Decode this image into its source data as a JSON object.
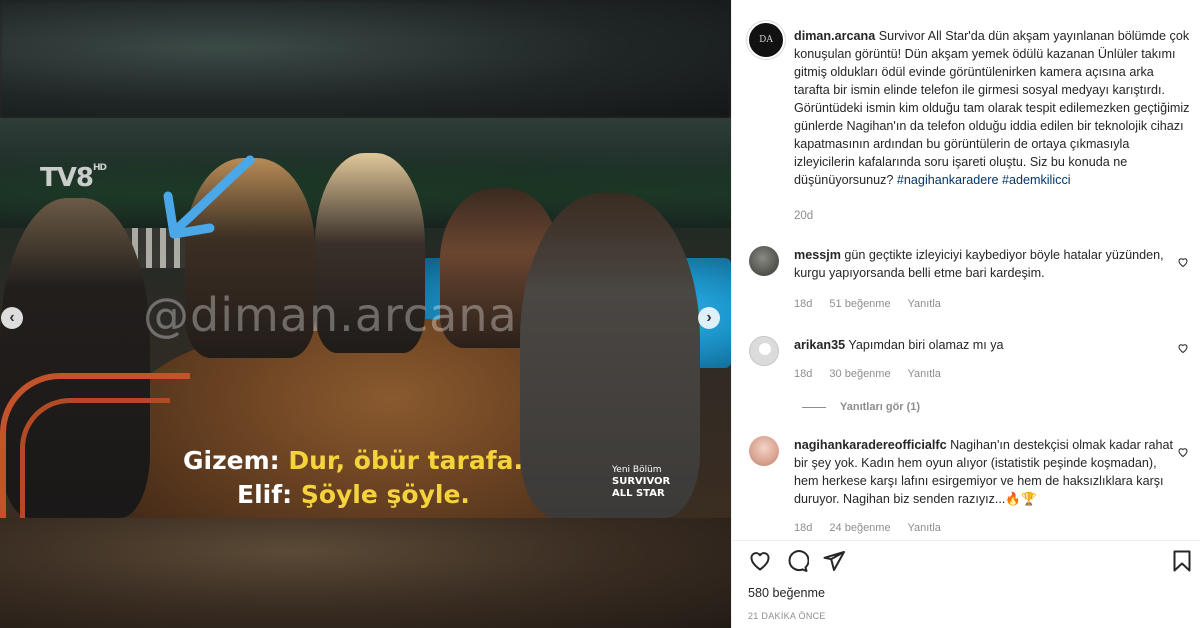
{
  "media": {
    "watermark": "@diman.arcana",
    "channel_logo": "TV8",
    "channel_logo_suffix": "HD",
    "subtitles": [
      {
        "speaker": "Gizem:",
        "line": "Dur, öbür tarafa."
      },
      {
        "speaker": "Elif:",
        "line": "Şöyle şöyle."
      }
    ],
    "brand_small": "Yeni Bölüm",
    "brand_title_1": "SURVIVOR",
    "brand_title_2": "ALL STAR",
    "prev_icon": "‹",
    "next_icon": "›",
    "arrow_color": "#4aa8e8"
  },
  "post": {
    "username": "diman.arcana",
    "avatar_text": "DA",
    "caption": "Survivor All Star'da dün akşam yayınlanan bölümde çok konuşulan görüntü! Dün akşam yemek ödülü kazanan Ünlüler takımı gitmiş oldukları ödül evinde görüntülenirken kamera açısına arka tarafta bir ismin elinde telefon ile girmesi sosyal medyayı karıştırdı. Görüntüdeki ismin kim olduğu tam olarak tespit edilemezken geçtiğimiz günlerde Nagihan'ın da telefon olduğu iddia edilen bir teknolojik cihazı kapatmasının ardından bu görüntülerin de ortaya çıkmasıyla izleyicilerin kafalarında soru işareti oluştu. Siz bu konuda ne düşünüyorsunuz?",
    "hashtag_1": "#nagihankaradere",
    "hashtag_2": "#ademkilicci",
    "time": "20d"
  },
  "comments": [
    {
      "username": "messjm",
      "text": "gün geçtikte izleyiciyi kaybediyor böyle hatalar yüzünden, kurgu yapıyorsanda belli etme bari kardeşim.",
      "time": "18d",
      "likes": "51 beğenme",
      "reply": "Yanıtla"
    },
    {
      "username": "arikan35",
      "text": "Yapımdan biri olamaz mı ya",
      "time": "18d",
      "likes": "30 beğenme",
      "reply": "Yanıtla"
    },
    {
      "username": "nagihankaradereofficialfc",
      "text": "Nagihan'ın destekçisi olmak kadar rahat bir şey yok. Kadın hem oyun alıyor (istatistik peşinde koşmadan), hem herkese karşı lafını esirgemiyor ve hem de haksızlıklara karşı duruyor. Nagihan biz senden razıyız...🔥🏆",
      "time": "18d",
      "likes": "24 beğenme",
      "reply": "Yanıtla"
    }
  ],
  "view_replies": "Yanıtları gör (1)",
  "likes_count": "580 beğenme",
  "timestamp": "21 DAKİKA ÖNCE"
}
